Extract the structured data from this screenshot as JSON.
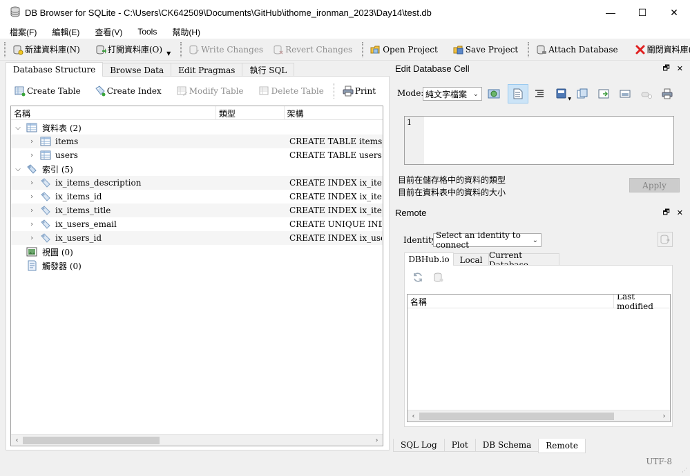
{
  "window": {
    "title": "DB Browser for SQLite - C:\\Users\\CK642509\\Documents\\GitHub\\ithome_ironman_2023\\Day14\\test.db",
    "controls": {
      "minimize": "—",
      "maximize": "☐",
      "close": "✕"
    }
  },
  "menu": {
    "file": "檔案(F)",
    "edit": "編輯(E)",
    "view": "查看(V)",
    "tools": "Tools",
    "help": "幫助(H)"
  },
  "toolbar": {
    "new_db": "新建資料庫(N)",
    "open_db": "打開資料庫(O)",
    "write_changes": "Write Changes",
    "revert_changes": "Revert Changes",
    "open_project": "Open Project",
    "save_project": "Save Project",
    "attach_db": "Attach Database",
    "close_db": "關閉資料庫(C)"
  },
  "left_tabs": [
    "Database Structure",
    "Browse Data",
    "Edit Pragmas",
    "執行 SQL"
  ],
  "structure_toolbar": {
    "create_table": "Create Table",
    "create_index": "Create Index",
    "modify_table": "Modify Table",
    "delete_table": "Delete Table",
    "print": "Print"
  },
  "tree": {
    "columns": [
      "名稱",
      "類型",
      "架構"
    ],
    "rows": [
      {
        "name": "資料表 (2)",
        "schema": ""
      },
      {
        "name": "items",
        "schema": "CREATE TABLE items ( id"
      },
      {
        "name": "users",
        "schema": "CREATE TABLE users ( id"
      },
      {
        "name": "索引 (5)",
        "schema": ""
      },
      {
        "name": "ix_items_description",
        "schema": "CREATE INDEX ix_items_"
      },
      {
        "name": "ix_items_id",
        "schema": "CREATE INDEX ix_items_"
      },
      {
        "name": "ix_items_title",
        "schema": "CREATE INDEX ix_items_"
      },
      {
        "name": "ix_users_email",
        "schema": "CREATE UNIQUE INDEX"
      },
      {
        "name": "ix_users_id",
        "schema": "CREATE INDEX ix_users_"
      },
      {
        "name": "視圖 (0)",
        "schema": ""
      },
      {
        "name": "觸發器 (0)",
        "schema": ""
      }
    ]
  },
  "edit_cell": {
    "title": "Edit Database Cell",
    "mode_label": "Mode:",
    "mode_value": "純文字檔案",
    "line_number": "1",
    "type_info": "目前在儲存格中的資料的類型",
    "size_info": "目前在資料表中的資料的大小",
    "apply": "Apply"
  },
  "remote": {
    "title": "Remote",
    "identity_label": "Identity",
    "identity_value": "Select an identity to connect",
    "tabs": [
      "DBHub.io",
      "Local",
      "Current Database"
    ],
    "columns": [
      "名稱",
      "Last modified"
    ]
  },
  "bottom_tabs": [
    "SQL Log",
    "Plot",
    "DB Schema",
    "Remote"
  ],
  "status": {
    "encoding": "UTF-8"
  },
  "dock_buttons": {
    "float": "🗗",
    "close": "✕"
  }
}
